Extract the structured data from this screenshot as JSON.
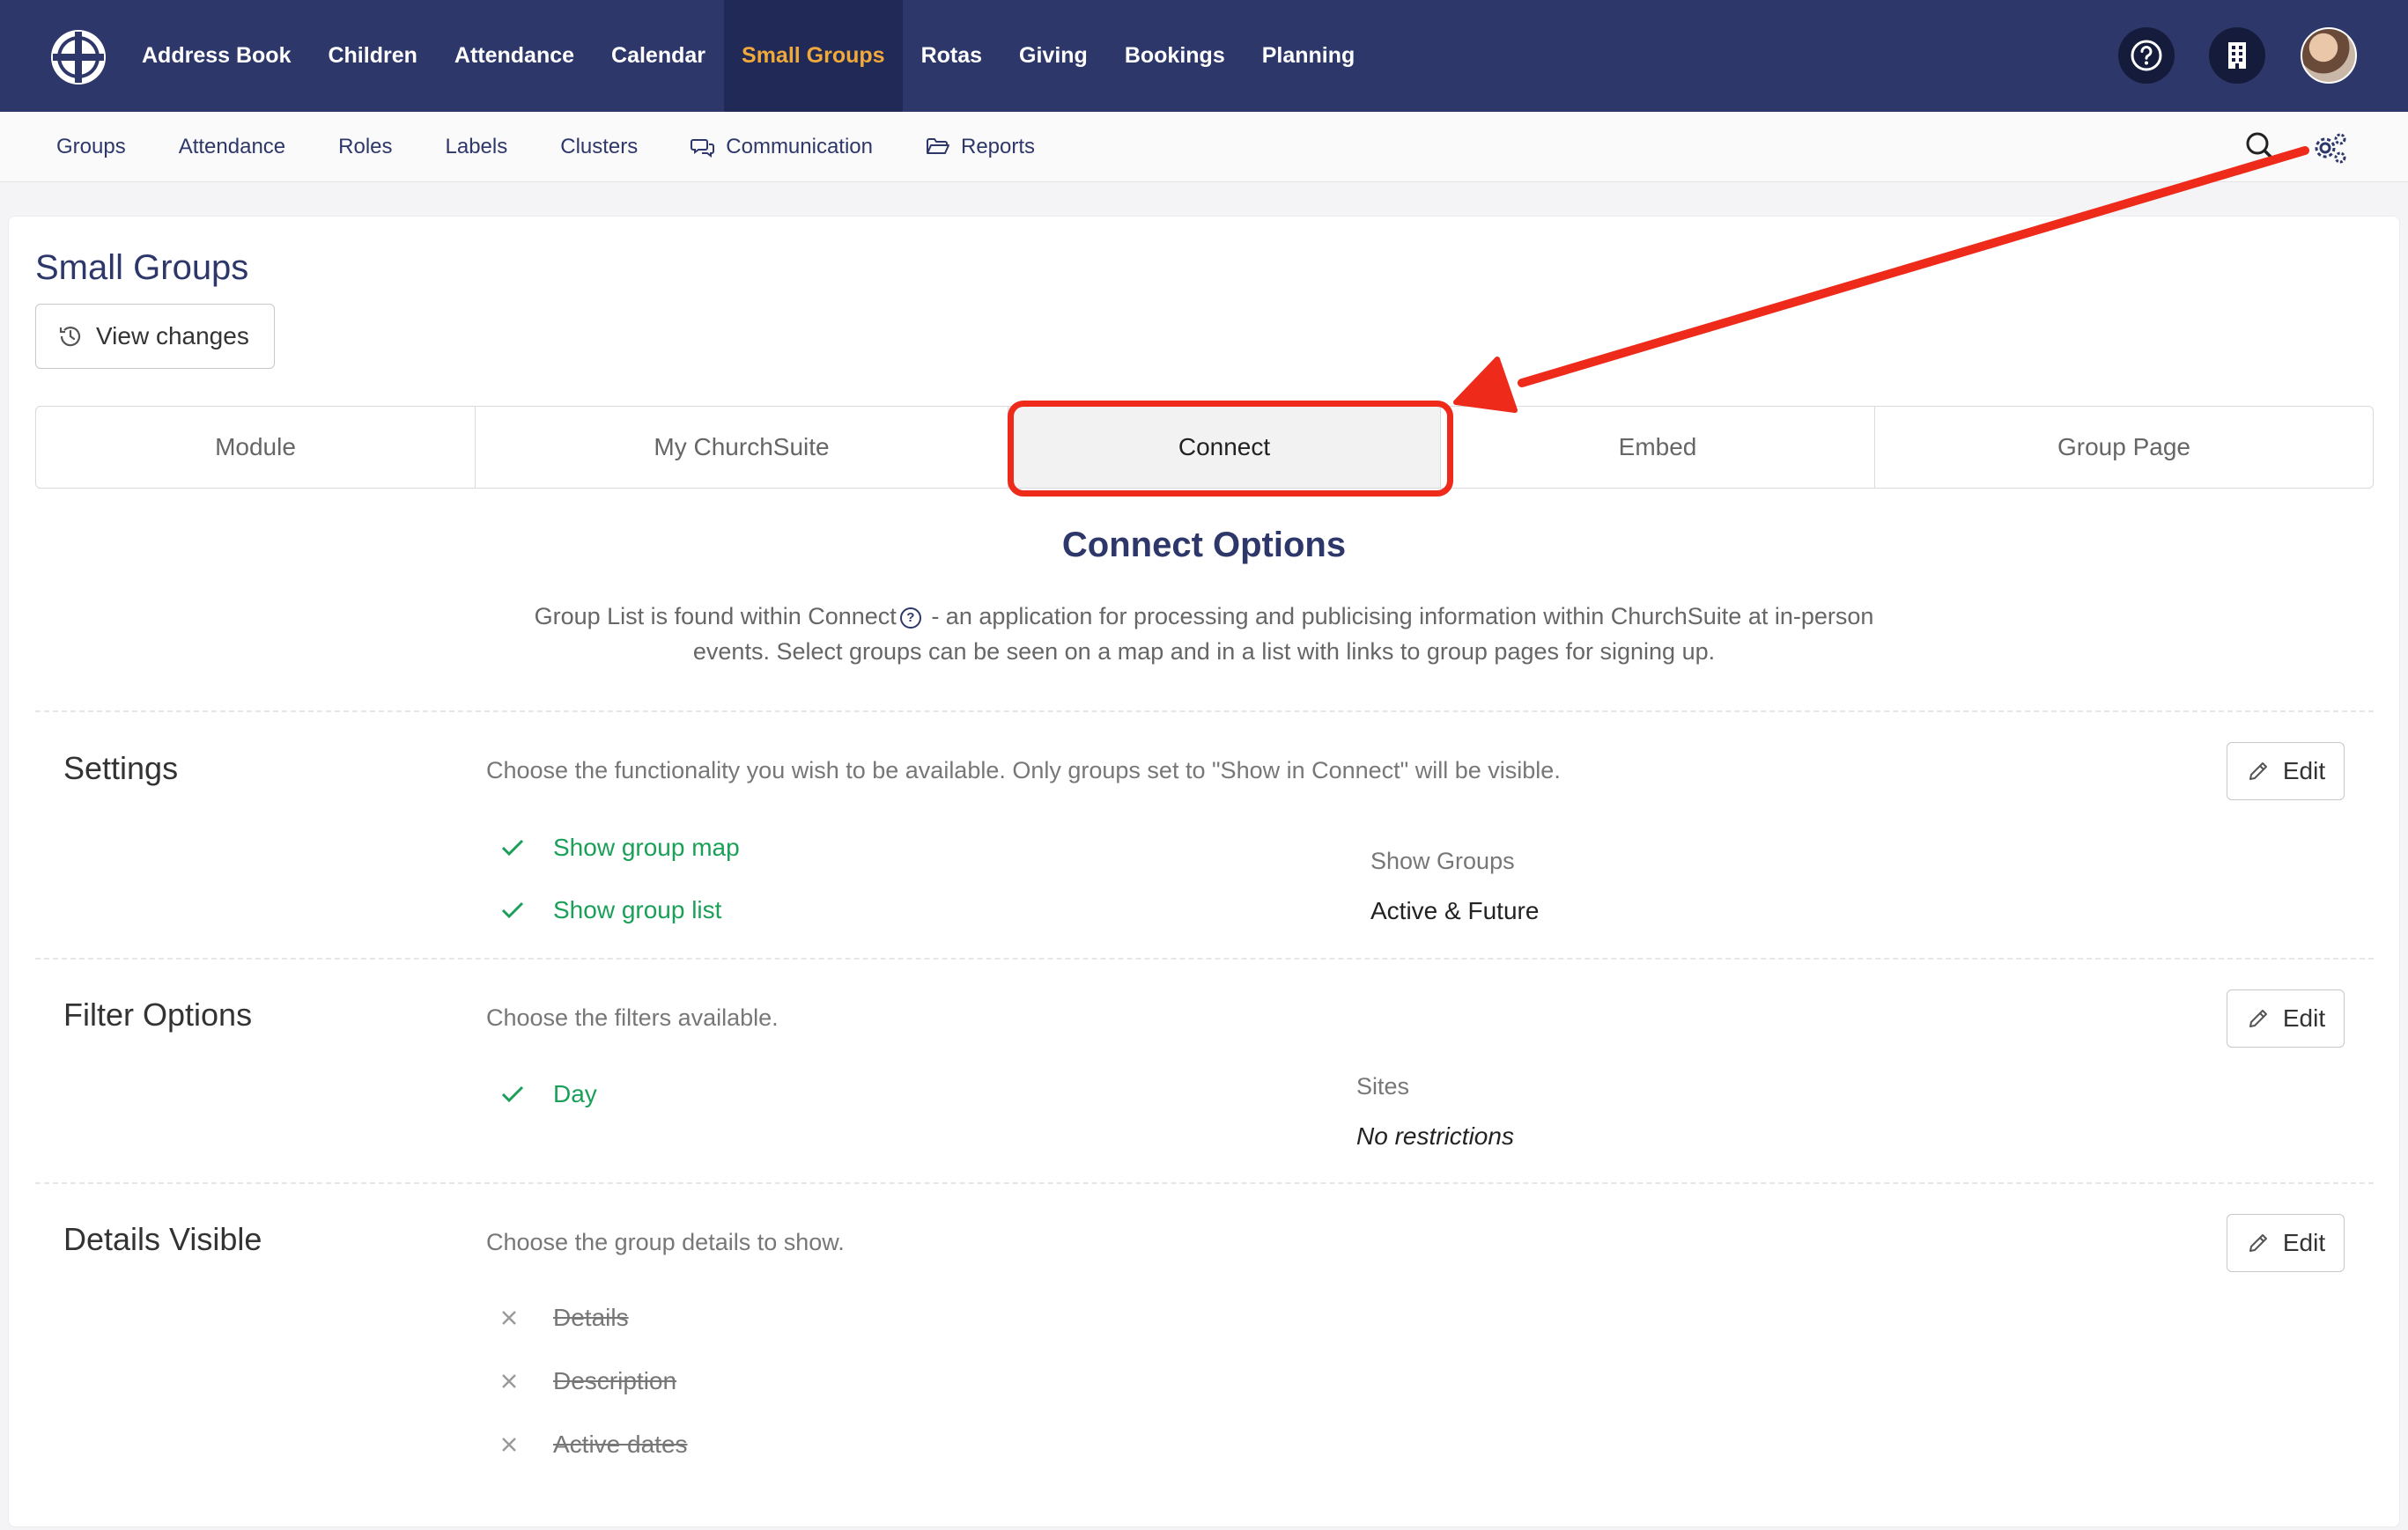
{
  "topnav": {
    "items": [
      "Address Book",
      "Children",
      "Attendance",
      "Calendar",
      "Small Groups",
      "Rotas",
      "Giving",
      "Bookings",
      "Planning"
    ],
    "active": "Small Groups",
    "icons": [
      "help-icon",
      "building-icon",
      "avatar"
    ]
  },
  "subnav": {
    "items": [
      "Groups",
      "Attendance",
      "Roles",
      "Labels",
      "Clusters",
      "Communication",
      "Reports"
    ]
  },
  "page": {
    "title": "Small Groups",
    "view_changes": "View changes"
  },
  "tabs": [
    "Module",
    "My ChurchSuite",
    "Connect",
    "Embed",
    "Group Page"
  ],
  "active_tab": "Connect",
  "connect": {
    "heading": "Connect Options",
    "intro_before": "Group List is found within Connect",
    "intro_after": " - an application for processing and publicising information within ChurchSuite at in-person events. Select groups can be seen on a map and in a list with links to group pages for signing up."
  },
  "settings": {
    "title": "Settings",
    "description": "Choose the functionality you wish to be available. Only groups set to \"Show in Connect\" will be visible.",
    "edit": "Edit",
    "options": [
      "Show group map",
      "Show group list"
    ],
    "show_groups_label": "Show Groups",
    "show_groups_value": "Active & Future"
  },
  "filters": {
    "title": "Filter Options",
    "description": "Choose the filters available.",
    "edit": "Edit",
    "options": [
      "Day"
    ],
    "sites_label": "Sites",
    "sites_value": "No restrictions"
  },
  "details": {
    "title": "Details Visible",
    "description": "Choose the group details to show.",
    "edit": "Edit",
    "options": [
      "Details",
      "Description",
      "Active dates"
    ]
  },
  "colors": {
    "nav_bg": "#2e376a",
    "nav_active_bg": "#212a57",
    "nav_active_text": "#f0a93a",
    "check_green": "#1aa058",
    "annotation_red": "#ee2a1b"
  }
}
